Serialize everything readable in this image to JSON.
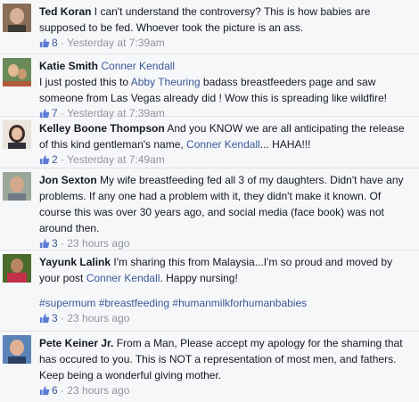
{
  "comments": [
    {
      "author": "Ted Koran",
      "text": " I can't understand the controversy? This is how babies are supposed to be fed. Whoever took the picture is an ass.",
      "likes": "8",
      "time": "Yesterday at 7:39am"
    },
    {
      "author": "Katie Smith",
      "mention": "Conner Kendall",
      "text_before": "I just posted this to ",
      "tag": "Abby Theuring",
      "text_after": " badass breastfeeders page and saw someone from Las Vegas already did ! Wow this is spreading like wildfire!",
      "likes": "7",
      "time": "Yesterday at 7:39am"
    },
    {
      "author": "Kelley Boone Thompson",
      "text_before": " And you KNOW we are all anticipating the release of this kind gentleman's name, ",
      "mention": "Conner Kendall",
      "text_after": "... HAHA!!!",
      "likes": "2",
      "time": "Yesterday at 7:49am"
    },
    {
      "author": "Jon Sexton",
      "text": " My wife breastfeeding fed all 3 of my daughters. Didn't have any problems. If any one had a problem with it, they didn't make it known. Of course this was over 30 years ago, and social media (face book) was not around then.",
      "likes": "3",
      "time": "23 hours ago"
    },
    {
      "author": "Yayunk Lalink",
      "text_before": " I'm sharing this from Malaysia...I'm so proud and moved by your post ",
      "mention": "Conner Kendall",
      "text_after": ". Happy nursing!",
      "hashtags": "#supermum #breastfeeding #humanmilkforhumanbabies",
      "likes": "3",
      "time": "23 hours ago"
    },
    {
      "author": "Pete Keiner Jr.",
      "text": " From a Man, Please accept my apology for the shaming that has occured to you. This is NOT a representation of most men, and fathers. Keep being a wonderful giving mother.",
      "likes": "6",
      "time": "23 hours ago"
    }
  ],
  "icons": {
    "like": "thumbs-up-icon"
  },
  "colors": {
    "link": "#3b5998",
    "meta": "#90949c",
    "background": "#f6f7f9"
  }
}
